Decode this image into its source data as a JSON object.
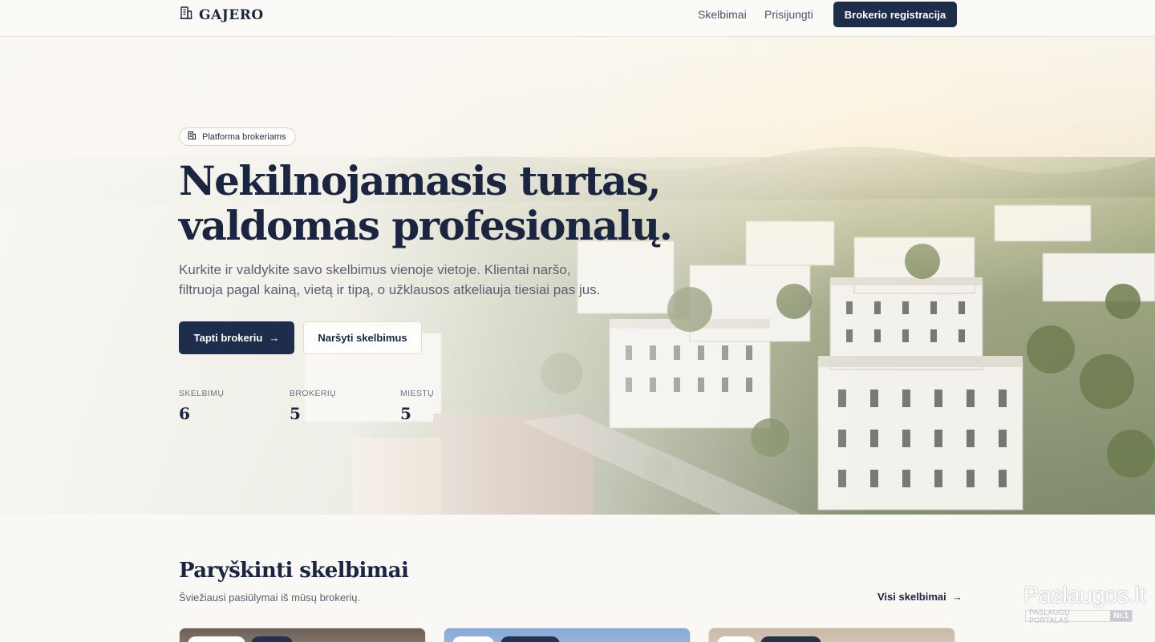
{
  "header": {
    "logo_text": "GAJERO",
    "logo_icon": "building-icon",
    "nav": [
      {
        "label": "Skelbimai"
      },
      {
        "label": "Prisijungti"
      }
    ],
    "cta_label": "Brokerio registracija"
  },
  "hero": {
    "badge_label": "Platforma brokeriams",
    "title_line1": "Nekilnojamasis turtas,",
    "title_line2": "valdomas profesionalų.",
    "subtitle": "Kurkite ir valdykite savo skelbimus vienoje vietoje. Klientai naršo, filtruoja pagal kainą, vietą ir tipą, o užklausos atkeliauja tiesiai pas jus.",
    "primary_button": "Tapti brokeriu",
    "primary_button_icon": "arrow-right-icon",
    "secondary_button": "Naršyti skelbimus",
    "stats": [
      {
        "label": "Skelbimų",
        "value": "6"
      },
      {
        "label": "Brokerių",
        "value": "5"
      },
      {
        "label": "Miestų",
        "value": "5"
      }
    ]
  },
  "featured": {
    "title": "Paryškinti skelbimai",
    "subtitle": "Šviežiausi pasiūlymai iš mūsų brokerių.",
    "see_all": "Visi skelbimai"
  },
  "watermark": {
    "brand": "Paslaugos.lt",
    "tagline": "PASLAUGŲ PORTALAS",
    "badge": "Nr.1"
  },
  "colors": {
    "primary": "#1f2d4d",
    "background": "#faf8f4",
    "text": "#1c2540",
    "muted": "#5a6072"
  }
}
